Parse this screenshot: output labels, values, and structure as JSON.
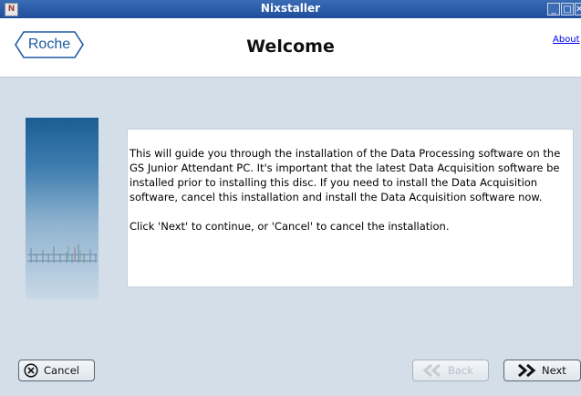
{
  "window": {
    "title": "Nixstaller"
  },
  "header": {
    "logo_text": "Roche",
    "page_title": "Welcome",
    "about_link": "About"
  },
  "content": {
    "paragraph1": "This will guide you through the installation of the Data Processing software on the GS Junior Attendant PC.  It's important that the latest Data Acquisition software be installed prior to installing this disc.  If you need to install the Data Acquisition software, cancel this installation and install the Data Acquisition software now.",
    "paragraph2": "Click 'Next' to continue, or 'Cancel' to cancel the installation."
  },
  "buttons": {
    "cancel": "Cancel",
    "back": "Back",
    "next": "Next"
  },
  "colors": {
    "titlebar": "#2a5aa6",
    "background": "#d3dee9",
    "brand": "#1d5aa3"
  },
  "icons": [
    "app-icon",
    "minimize-icon",
    "maximize-icon",
    "close-icon",
    "cancel-x-icon",
    "back-arrow-icon",
    "next-arrow-icon"
  ]
}
